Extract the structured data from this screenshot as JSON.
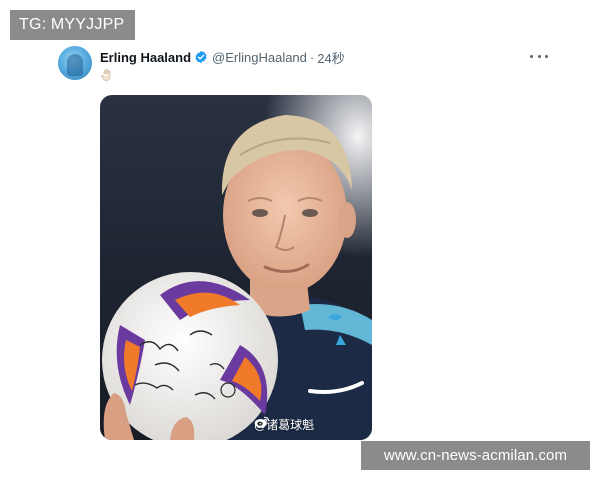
{
  "watermark_top": "TG: MYYJJPP",
  "tweet": {
    "display_name": "Erling Haaland",
    "handle": "@ErlingHaaland",
    "separator": "·",
    "time": "24秒",
    "verified": true,
    "accent_color": "#1d9bf0",
    "emoji_icon": "raised-hand-icon",
    "media": {
      "ball_icon": "signed-football",
      "weibo_credit": "@诸葛球魁"
    }
  },
  "watermark_bottom": "www.cn-news-acmilan.com"
}
